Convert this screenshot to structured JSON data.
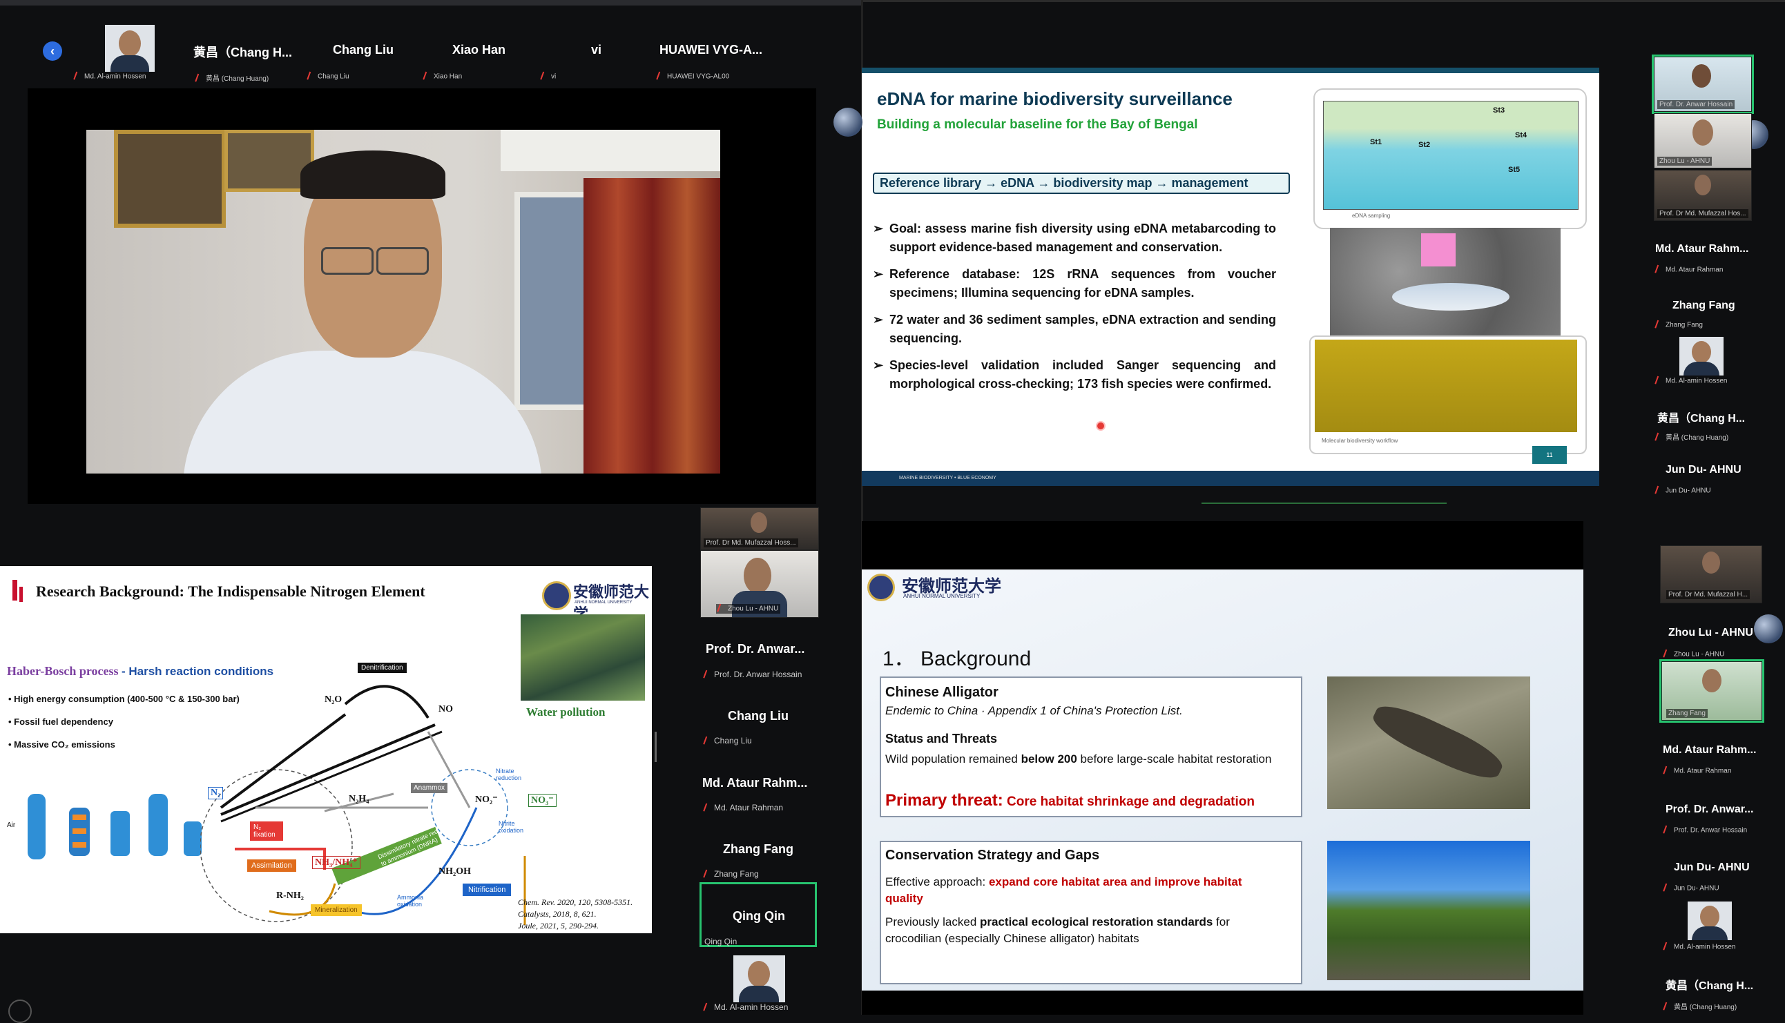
{
  "top_strip": {
    "participants": [
      {
        "name": "",
        "tag": "Md. Al-amin Hossen"
      },
      {
        "name": "黄昌（Chang H...",
        "tag": "黄昌 (Chang Huang)"
      },
      {
        "name": "Chang Liu",
        "tag": "Chang Liu"
      },
      {
        "name": "Xiao Han",
        "tag": "Xiao Han"
      },
      {
        "name": "vi",
        "tag": "vi"
      },
      {
        "name": "HUAWEI VYG-A...",
        "tag": "HUAWEI VYG-AL00"
      }
    ]
  },
  "left_slide": {
    "title": "Research Background: The Indispensable Nitrogen Element",
    "univ": "安徽师范大学",
    "univ_en": "ANHUI NORMAL UNIVERSITY",
    "haber": "Haber-Bosch process",
    "haber_sub": "- Harsh reaction conditions",
    "bullets": [
      "• High energy consumption (400-500 °C & 150-300 bar)",
      "• Fossil fuel dependency",
      "• Massive CO₂ emissions"
    ],
    "water_pollution": "Water pollution",
    "labels": {
      "denitrification": "Denitrification",
      "n2o": "N₂O",
      "no": "NO",
      "n2": "N₂",
      "n2h4": "N₂H₄",
      "anammox": "Anammox",
      "no2": "NO₂⁻",
      "no3": "NO₃⁻",
      "nitrate_reduction": "Nitrate reduction",
      "nitrite_oxidation": "Nitrite oxidation",
      "n2_fixation": "N₂ fixation",
      "assimilation": "Assimilation",
      "nh3": "NH₃/NH₄⁺",
      "dnra": "Dissimilatory nitrate reduction to ammonium (DNRA)",
      "rnh2": "R-NH₂",
      "mineralization": "Mineralization",
      "nh2oh": "NH₂OH",
      "ammonia_oxidation": "Ammonia oxidation",
      "nitrification": "Nitrification",
      "air": "Air"
    },
    "refs": [
      "Chem. Rev. 2020, 120, 5308-5351.",
      "Catalysts, 2018, 8, 621.",
      "Joule, 2021, 5, 290-294."
    ]
  },
  "mid_column": {
    "video_tags": [
      "Prof. Dr Md. Mufazzal Hoss...",
      "Zhou Lu - AHNU"
    ],
    "tiles": [
      {
        "name": "Prof. Dr. Anwar...",
        "tag": "Prof. Dr. Anwar Hossain"
      },
      {
        "name": "Chang Liu",
        "tag": "Chang Liu"
      },
      {
        "name": "Md. Ataur Rahm...",
        "tag": "Md. Ataur Rahman"
      },
      {
        "name": "Zhang Fang",
        "tag": "Zhang Fang"
      },
      {
        "name": "Qing Qin",
        "tag": "Qing Qin"
      }
    ],
    "last_tag": "Md. Al-amin Hossen"
  },
  "edna_slide": {
    "title": "eDNA for marine biodiversity surveillance",
    "subtitle": "Building a molecular baseline for the Bay of Bengal",
    "flow": "Reference library → eDNA → biodiversity map → management",
    "bullets": [
      "Goal: assess marine fish diversity using eDNA metabarcoding to support evidence-based management and conservation.",
      "Reference database: 12S rRNA sequences from voucher specimens; Illumina sequencing for eDNA samples.",
      "72 water and 36 sediment samples, eDNA extraction and sending sequencing.",
      "Species-level validation included Sanger sequencing and morphological cross-checking; 173 fish species were confirmed."
    ],
    "map_caption": "eDNA sampling",
    "gel_caption": "Molecular biodiversity workflow",
    "footer": "MARINE BIODIVERSITY • BLUE ECONOMY",
    "page": "11",
    "stations": [
      "St3",
      "St4",
      "St5",
      "St1",
      "St2"
    ]
  },
  "bg_slide": {
    "univ": "安徽师范大学",
    "univ_en": "ANHUI NORMAL UNIVERSITY",
    "heading": "1． Background",
    "box1": {
      "title": "Chinese Alligator",
      "sub": "Endemic to China · Appendix 1 of China's Protection List.",
      "status_title": "Status and Threats",
      "status_pre": "Wild population remained ",
      "status_bold": "below 200",
      "status_post": " before large-scale habitat restoration",
      "threat_label": "Primary threat:",
      "threat_text": " Core habitat shrinkage and degradation"
    },
    "box2": {
      "title": "Conservation Strategy and Gaps",
      "eff_pre": "Effective approach: ",
      "eff_red": "expand core habitat area and improve habitat quality",
      "gap_pre": "Previously lacked ",
      "gap_bold": "practical ecological restoration standards",
      "gap_post": " for crocodilian (especially Chinese alligator) habitats"
    }
  },
  "right_column_top": {
    "video_tags": [
      "Prof. Dr. Anwar Hossain",
      "Zhou Lu - AHNU",
      "Prof. Dr Md. Mufazzal Hos..."
    ],
    "tiles": [
      {
        "name": "Md. Ataur Rahm...",
        "tag": "Md. Ataur Rahman"
      },
      {
        "name": "Zhang Fang",
        "tag": "Zhang Fang"
      }
    ],
    "avatar_tag": "Md. Al-amin Hossen",
    "tiles2": [
      {
        "name": "黄昌（Chang H...",
        "tag": "黄昌 (Chang Huang)"
      },
      {
        "name": "Jun Du- AHNU",
        "tag": "Jun Du- AHNU"
      }
    ]
  },
  "right_column_bottom": {
    "video_tags": [
      "Prof. Dr Md. Mufazzal H...",
      "Zhang Fang"
    ],
    "tiles": [
      {
        "name": "Zhou Lu - AHNU",
        "tag": "Zhou Lu - AHNU"
      },
      {
        "name": "Md. Ataur Rahm...",
        "tag": "Md. Ataur Rahman"
      },
      {
        "name": "Prof. Dr. Anwar...",
        "tag": "Prof. Dr. Anwar Hossain"
      },
      {
        "name": "Jun Du- AHNU",
        "tag": "Jun Du- AHNU"
      }
    ],
    "avatar_tag": "Md. Al-amin Hossen",
    "last": {
      "name": "黄昌（Chang H...",
      "tag": "黄昌 (Chang Huang)"
    }
  }
}
